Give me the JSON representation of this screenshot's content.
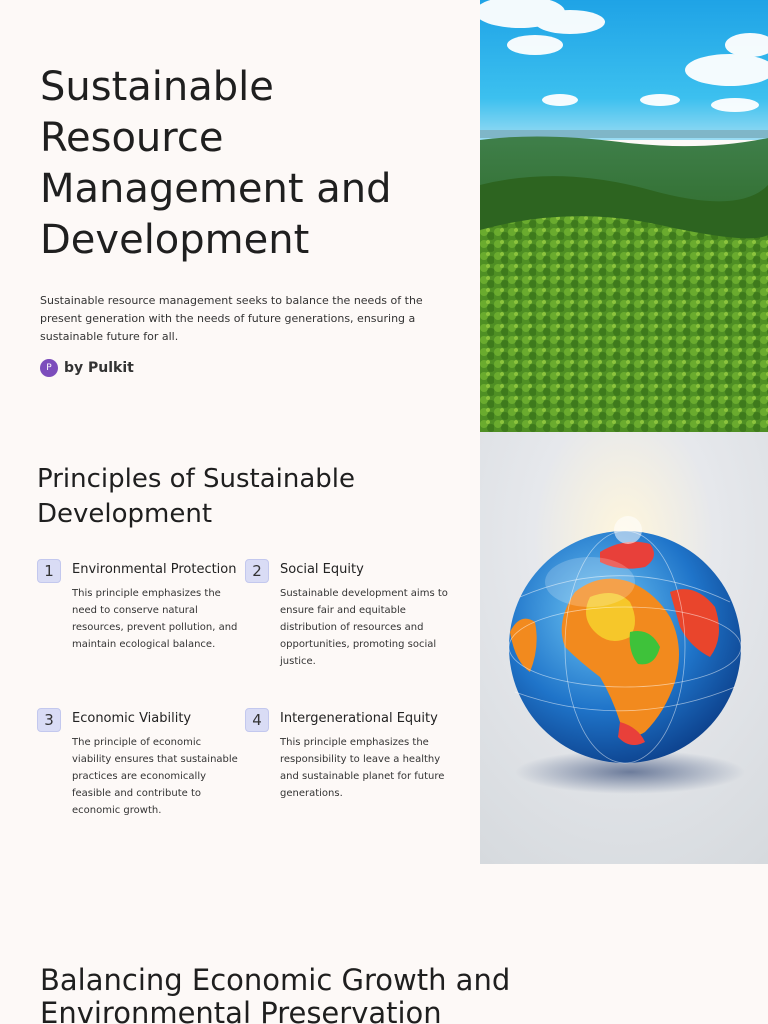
{
  "hero": {
    "title": "Sustainable Resource Management and Development",
    "description": "Sustainable resource management seeks to balance the needs of the present generation with the needs of future generations, ensuring a sustainable future for all.",
    "author_initial": "P",
    "author": "by Pulkit"
  },
  "principles": {
    "title": "Principles of Sustainable Development",
    "items": [
      {
        "number": "1",
        "title": "Environmental Protection",
        "description": "This principle emphasizes the need to conserve natural resources, prevent pollution, and maintain ecological balance."
      },
      {
        "number": "2",
        "title": "Social Equity",
        "description": "Sustainable development aims to ensure fair and equitable distribution of resources and opportunities, promoting social justice."
      },
      {
        "number": "3",
        "title": "Economic Viability",
        "description": "The principle of economic viability ensures that sustainable practices are economically feasible and contribute to economic growth."
      },
      {
        "number": "4",
        "title": "Intergenerational Equity",
        "description": "This principle emphasizes the responsibility to leave a healthy and sustainable planet for future generations."
      }
    ]
  },
  "balance": {
    "title": "Balancing Economic Growth and Environmental Preservation"
  },
  "colors": {
    "background": "#fdf9f7",
    "avatar": "#7c4dbc",
    "number_badge": "#d9dcf5"
  }
}
